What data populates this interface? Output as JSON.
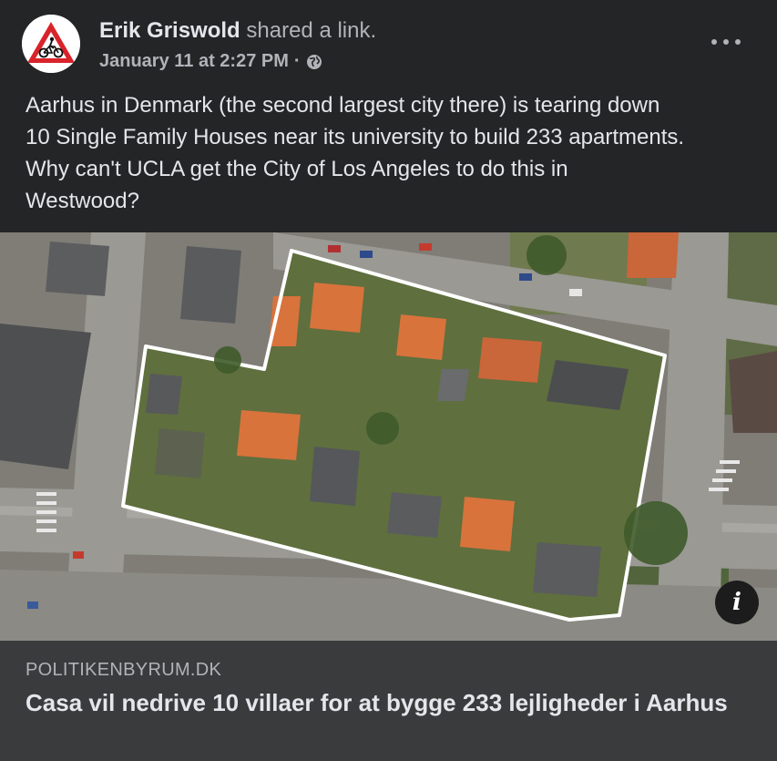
{
  "post": {
    "author": "Erik Griswold",
    "action": "shared a link.",
    "timestamp": "January 11 at 2:27 PM",
    "separator": "·",
    "audience_icon": "globe-icon",
    "more_icon": "more-options-icon",
    "text_lines": [
      "Aarhus in Denmark (the second largest city there) is tearing down",
      "10 Single Family Houses near its university to build 233 apartments.",
      "Why can't UCLA get the City of Los Angeles to do this in",
      "Westwood?"
    ]
  },
  "avatar": {
    "icon": "cyclist-warning-sign-icon"
  },
  "link_preview": {
    "image_alt": "aerial photo of a city block outlined in white",
    "info_label": "i",
    "domain": "POLITIKENBYRUM.DK",
    "title": "Casa vil nedrive 10 villaer for at bygge 233 lejligheder i Aarhus"
  },
  "colors": {
    "background": "#242526",
    "card": "#3a3b3c",
    "primary_text": "#e4e6eb",
    "secondary_text": "#b0b3b8",
    "sign_red": "#d9232a"
  }
}
